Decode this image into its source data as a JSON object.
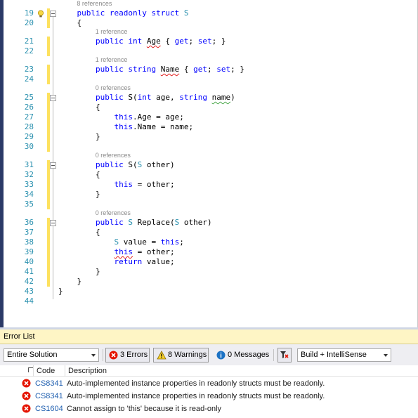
{
  "editor": {
    "lines": [
      {
        "num": "19",
        "refs": "8 references",
        "tokens": [
          {
            "t": "    public",
            "c": "kw"
          },
          {
            "t": " "
          },
          {
            "t": "readonly",
            "c": "kw"
          },
          {
            "t": " "
          },
          {
            "t": "struct",
            "c": "kw"
          },
          {
            "t": " "
          },
          {
            "t": "S",
            "c": "ty"
          }
        ],
        "fold": true
      },
      {
        "num": "20",
        "tokens": [
          {
            "t": "    {"
          }
        ]
      },
      {
        "num": "21",
        "refs": "1 reference",
        "tokens": [
          {
            "t": "        "
          },
          {
            "t": "public",
            "c": "kw"
          },
          {
            "t": " "
          },
          {
            "t": "int",
            "c": "kw"
          },
          {
            "t": " "
          },
          {
            "t": "Age",
            "c": "squig"
          },
          {
            "t": " { "
          },
          {
            "t": "get",
            "c": "kw"
          },
          {
            "t": "; "
          },
          {
            "t": "set",
            "c": "kw"
          },
          {
            "t": "; }"
          }
        ]
      },
      {
        "num": "22",
        "tokens": []
      },
      {
        "num": "23",
        "refs": "1 reference",
        "tokens": [
          {
            "t": "        "
          },
          {
            "t": "public",
            "c": "kw"
          },
          {
            "t": " "
          },
          {
            "t": "string",
            "c": "kw"
          },
          {
            "t": " "
          },
          {
            "t": "Name",
            "c": "squig"
          },
          {
            "t": " { "
          },
          {
            "t": "get",
            "c": "kw"
          },
          {
            "t": "; "
          },
          {
            "t": "set",
            "c": "kw"
          },
          {
            "t": "; }"
          }
        ]
      },
      {
        "num": "24",
        "tokens": []
      },
      {
        "num": "25",
        "refs": "0 references",
        "tokens": [
          {
            "t": "        "
          },
          {
            "t": "public",
            "c": "kw"
          },
          {
            "t": " S("
          },
          {
            "t": "int",
            "c": "kw"
          },
          {
            "t": " age, "
          },
          {
            "t": "string",
            "c": "kw"
          },
          {
            "t": " "
          },
          {
            "t": "name",
            "c": "squig-g"
          },
          {
            "t": ")"
          }
        ],
        "fold": true
      },
      {
        "num": "26",
        "tokens": [
          {
            "t": "        {"
          }
        ]
      },
      {
        "num": "27",
        "tokens": [
          {
            "t": "            "
          },
          {
            "t": "this",
            "c": "kw"
          },
          {
            "t": ".Age = age;"
          }
        ]
      },
      {
        "num": "28",
        "tokens": [
          {
            "t": "            "
          },
          {
            "t": "this",
            "c": "kw"
          },
          {
            "t": ".Name = name;"
          }
        ]
      },
      {
        "num": "29",
        "tokens": [
          {
            "t": "        }"
          }
        ]
      },
      {
        "num": "30",
        "tokens": []
      },
      {
        "num": "31",
        "refs": "0 references",
        "tokens": [
          {
            "t": "        "
          },
          {
            "t": "public",
            "c": "kw"
          },
          {
            "t": " S("
          },
          {
            "t": "S",
            "c": "ty"
          },
          {
            "t": " other)"
          }
        ],
        "fold": true
      },
      {
        "num": "32",
        "tokens": [
          {
            "t": "        {"
          }
        ]
      },
      {
        "num": "33",
        "tokens": [
          {
            "t": "            "
          },
          {
            "t": "this",
            "c": "kw"
          },
          {
            "t": " = other;"
          }
        ]
      },
      {
        "num": "34",
        "tokens": [
          {
            "t": "        }"
          }
        ]
      },
      {
        "num": "35",
        "tokens": []
      },
      {
        "num": "36",
        "refs": "0 references",
        "tokens": [
          {
            "t": "        "
          },
          {
            "t": "public",
            "c": "kw"
          },
          {
            "t": " "
          },
          {
            "t": "S",
            "c": "ty"
          },
          {
            "t": " Replace("
          },
          {
            "t": "S",
            "c": "ty"
          },
          {
            "t": " other)"
          }
        ],
        "fold": true
      },
      {
        "num": "37",
        "tokens": [
          {
            "t": "        {"
          }
        ]
      },
      {
        "num": "38",
        "tokens": [
          {
            "t": "            "
          },
          {
            "t": "S",
            "c": "ty"
          },
          {
            "t": " value = "
          },
          {
            "t": "this",
            "c": "kw"
          },
          {
            "t": ";"
          }
        ]
      },
      {
        "num": "39",
        "tokens": [
          {
            "t": "            "
          },
          {
            "t": "this",
            "c": "kw squig"
          },
          {
            "t": " = other;"
          }
        ]
      },
      {
        "num": "40",
        "tokens": [
          {
            "t": "            "
          },
          {
            "t": "return",
            "c": "kw"
          },
          {
            "t": " value;"
          }
        ]
      },
      {
        "num": "41",
        "tokens": [
          {
            "t": "        }"
          }
        ]
      },
      {
        "num": "42",
        "tokens": [
          {
            "t": "    }"
          }
        ]
      },
      {
        "num": "43",
        "tokens": [
          {
            "t": "}"
          }
        ]
      },
      {
        "num": "44",
        "tokens": []
      }
    ]
  },
  "error_list": {
    "title": "Error List",
    "scope_value": "Entire Solution",
    "errors_label": "3 Errors",
    "warnings_label": "8 Warnings",
    "messages_label": "0 Messages",
    "source_value": "Build + IntelliSense",
    "col_code": "Code",
    "col_description": "Description",
    "rows": [
      {
        "code": "CS8341",
        "description": "Auto-implemented instance properties in readonly structs must be readonly."
      },
      {
        "code": "CS8341",
        "description": "Auto-implemented instance properties in readonly structs must be readonly."
      },
      {
        "code": "CS1604",
        "description": "Cannot assign to 'this' because it is read-only"
      }
    ]
  },
  "colors": {
    "keyword": "#0000ff",
    "type": "#2b91af",
    "line_number": "#2b91af",
    "change_marker": "#fde15e",
    "error_header": "#fef5c5",
    "error_icon": "#e51400",
    "link": "#1f5fb0"
  }
}
